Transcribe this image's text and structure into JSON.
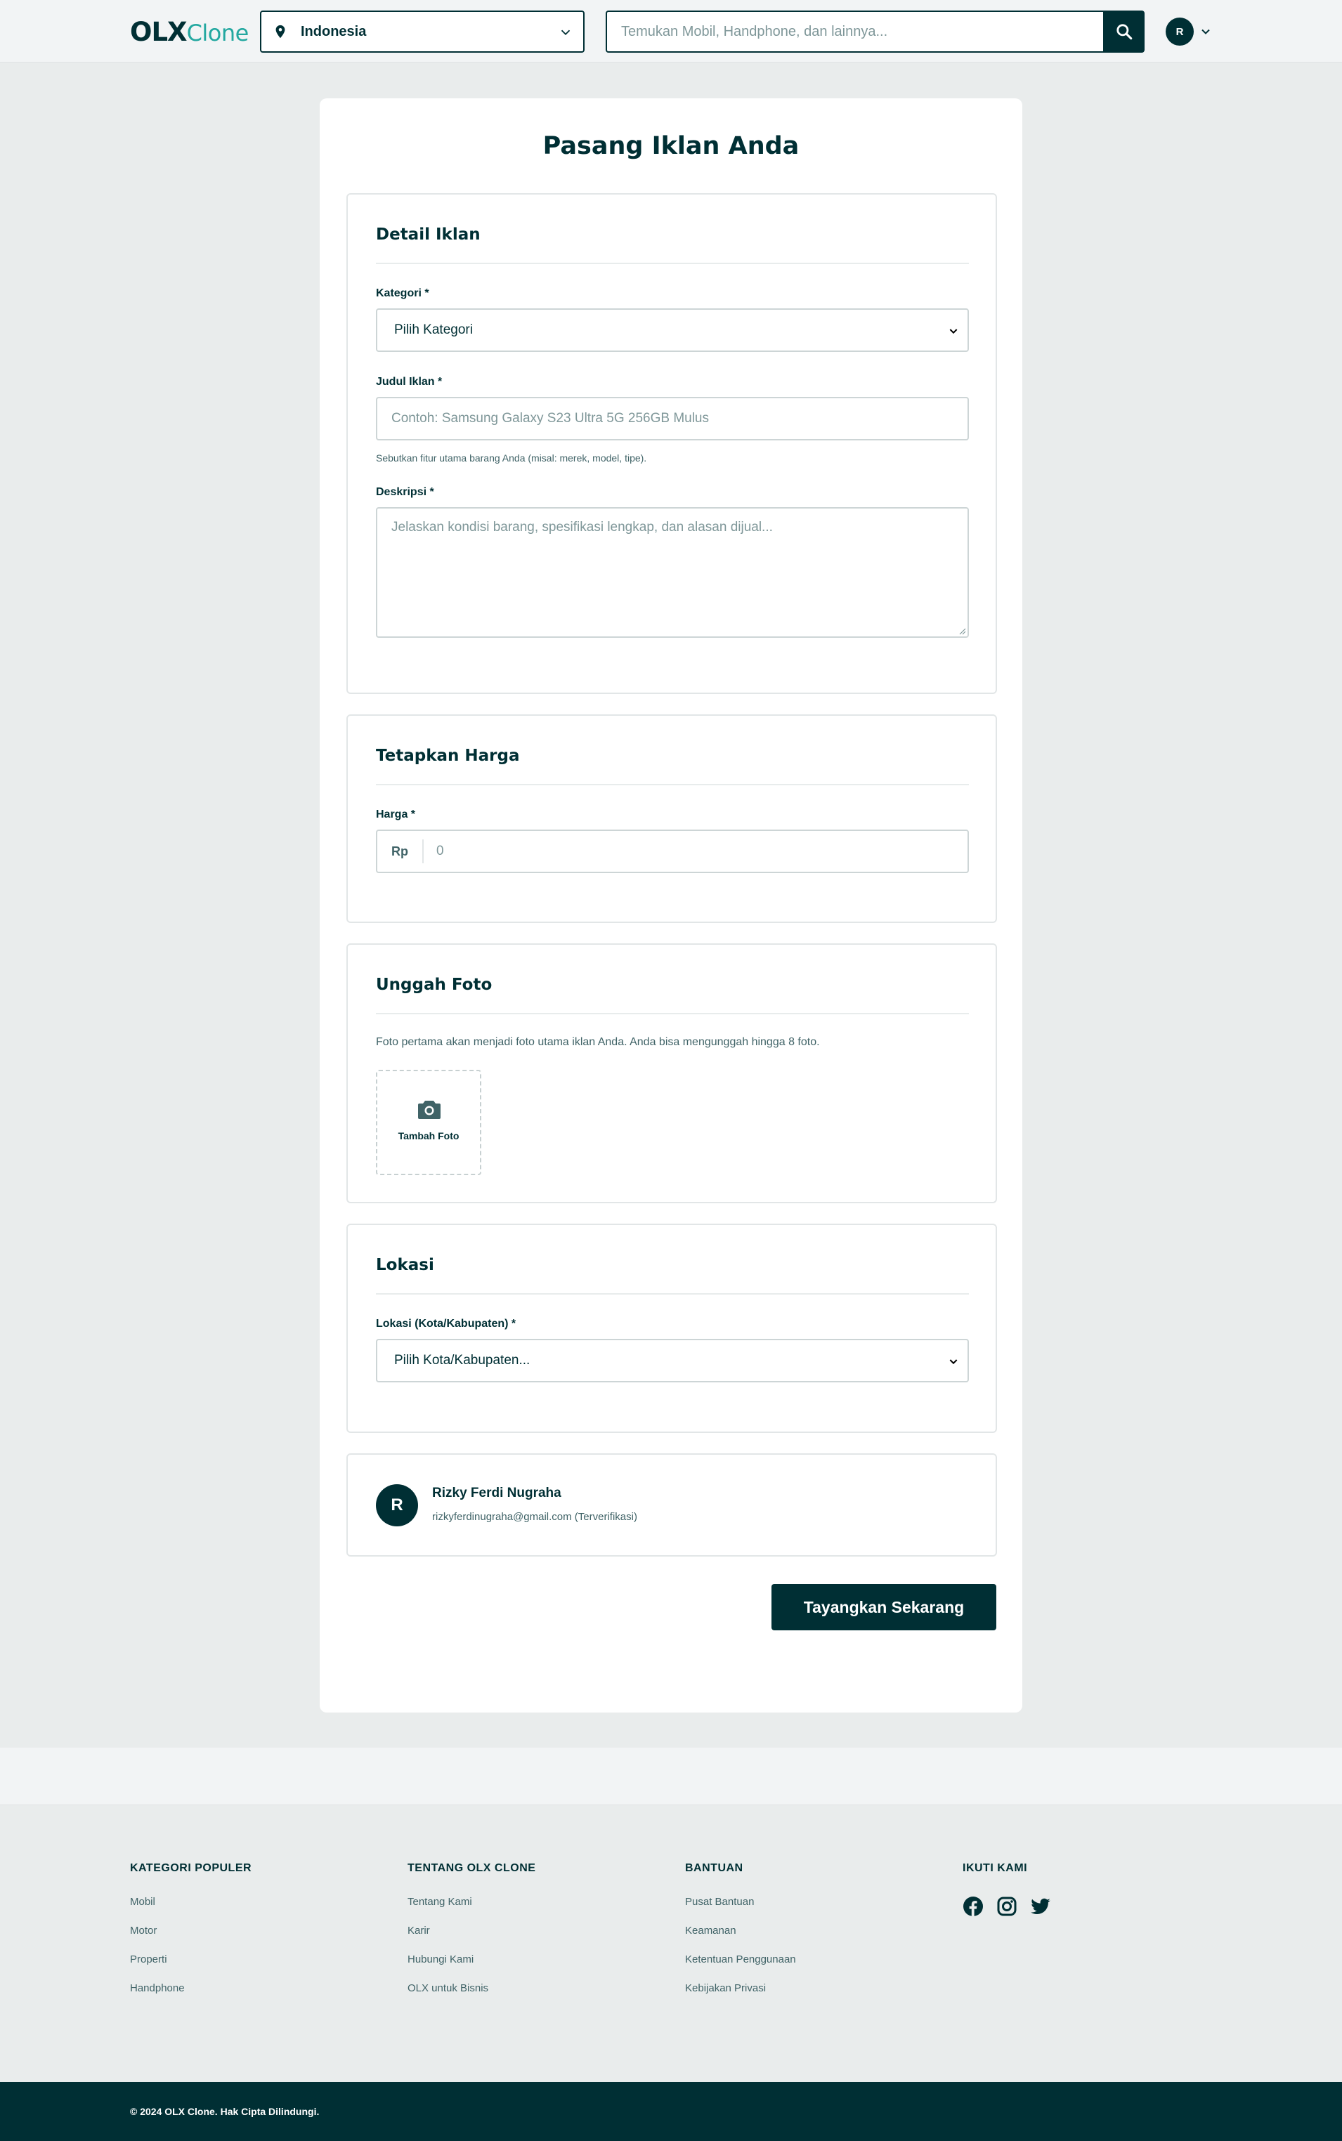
{
  "header": {
    "logo_main": "OLX",
    "logo_sub": "Clone",
    "location": "Indonesia",
    "search_placeholder": "Temukan Mobil, Handphone, dan lainnya...",
    "avatar_initial": "R"
  },
  "form": {
    "title": "Pasang Iklan Anda",
    "detail": {
      "title": "Detail Iklan",
      "category_label": "Kategori *",
      "category_value": "Pilih Kategori",
      "title_label": "Judul Iklan *",
      "title_placeholder": "Contoh: Samsung Galaxy S23 Ultra 5G 256GB Mulus",
      "title_hint": "Sebutkan fitur utama barang Anda (misal: merek, model, tipe).",
      "desc_label": "Deskripsi *",
      "desc_placeholder": "Jelaskan kondisi barang, spesifikasi lengkap, dan alasan dijual..."
    },
    "price": {
      "title": "Tetapkan Harga",
      "label": "Harga *",
      "prefix": "Rp",
      "placeholder": "0"
    },
    "photo": {
      "title": "Unggah Foto",
      "note": "Foto pertama akan menjadi foto utama iklan Anda. Anda bisa mengunggah hingga 8 foto.",
      "add_label": "Tambah Foto"
    },
    "location": {
      "title": "Lokasi",
      "label": "Lokasi (Kota/Kabupaten) *",
      "value": "Pilih Kota/Kabupaten..."
    },
    "user": {
      "initial": "R",
      "name": "Rizky Ferdi Nugraha",
      "email": "rizkyferdinugraha@gmail.com (Terverifikasi)"
    },
    "submit_label": "Tayangkan Sekarang"
  },
  "footer": {
    "columns": [
      {
        "heading": "KATEGORI POPULER",
        "links": [
          "Mobil",
          "Motor",
          "Properti",
          "Handphone"
        ]
      },
      {
        "heading": "TENTANG OLX CLONE",
        "links": [
          "Tentang Kami",
          "Karir",
          "Hubungi Kami",
          "OLX untuk Bisnis"
        ]
      },
      {
        "heading": "BANTUAN",
        "links": [
          "Pusat Bantuan",
          "Keamanan",
          "Ketentuan Penggunaan",
          "Kebijakan Privasi"
        ]
      }
    ],
    "follow_heading": "IKUTI KAMI",
    "social_icons": [
      "facebook-icon",
      "instagram-icon",
      "twitter-icon"
    ],
    "copyright": "© 2024 OLX Clone. Hak Cipta Dilindungi."
  },
  "colors": {
    "primary": "#002f34",
    "accent": "#23a8a0",
    "page_bg": "#e9ecec"
  }
}
